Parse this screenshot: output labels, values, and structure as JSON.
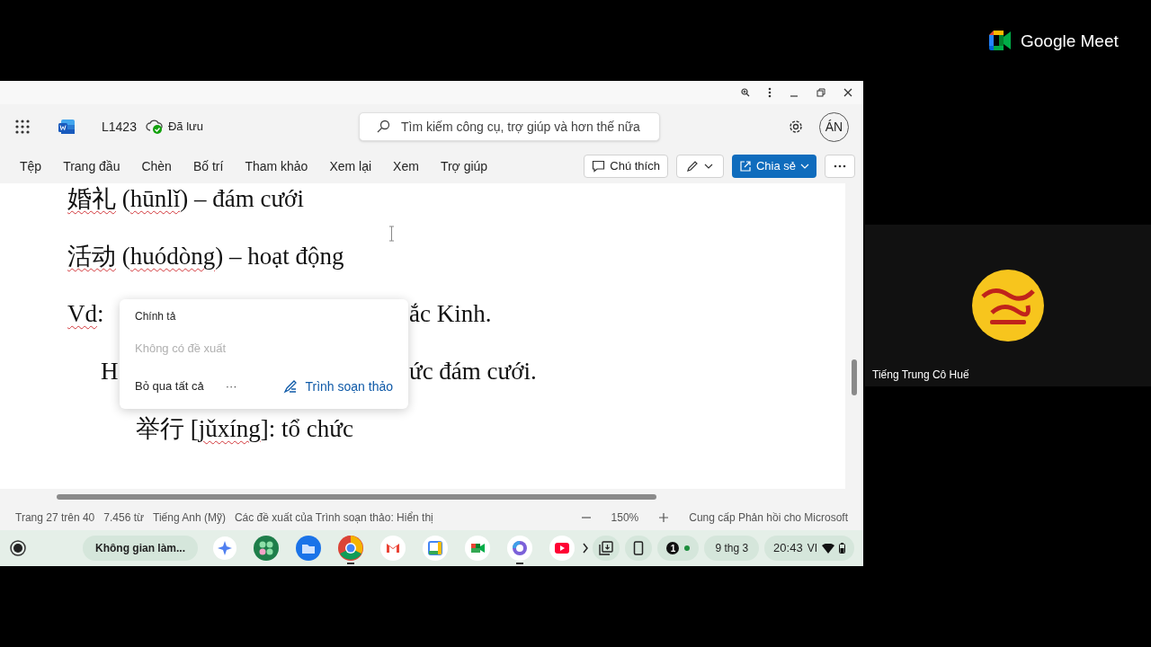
{
  "word": {
    "doc_name": "L1423",
    "save_status": "Đã lưu",
    "search": {
      "placeholder": "Tìm kiếm công cụ, trợ giúp và hơn thế nữa"
    },
    "avatar": "ÁN",
    "ribbon_tabs": [
      "Tệp",
      "Trang đầu",
      "Chèn",
      "Bố trí",
      "Tham khảo",
      "Xem lại",
      "Xem",
      "Trợ giúp"
    ],
    "comment_button": "Chú thích",
    "share_button": "Chia sẻ",
    "document": {
      "lines": [
        {
          "kind": "entry",
          "parts": [
            [
              {
                "text": "婚礼",
                "misspelled": true
              },
              {
                "text": " (",
                "misspelled": false
              },
              {
                "text": "hūnlǐ",
                "misspelled": true
              },
              {
                "text": ") – đám cưới",
                "misspelled": false
              }
            ]
          ]
        },
        {
          "kind": "entry",
          "parts": [
            [
              {
                "text": "活动",
                "misspelled": true
              },
              {
                "text": " (",
                "misspelled": false
              },
              {
                "text": "huódòng",
                "misspelled": true
              },
              {
                "text": ") – hoạt động",
                "misspelled": false
              }
            ]
          ]
        },
        {
          "kind": "entry",
          "parts": [
            [
              {
                "text": "Vd",
                "misspelled": true
              },
              {
                "text": ":",
                "misspelled": false
              }
            ],
            [
              {
                "text": "ắc Kinh.",
                "misspelled": false
              }
            ]
          ]
        },
        {
          "kind": "example",
          "parts": [
            [
              {
                "text": "H",
                "misspelled": false
              }
            ],
            [
              {
                "text": "ức đám cưới.",
                "misspelled": false
              }
            ]
          ]
        },
        {
          "kind": "vocab",
          "parts": [
            [
              {
                "text": "举行 [",
                "misspelled": false
              },
              {
                "text": "jǔxíng",
                "misspelled": true
              },
              {
                "text": "]: tổ chức",
                "misspelled": false
              }
            ]
          ]
        }
      ]
    },
    "spelling_popup": {
      "title": "Chính tả",
      "empty_message": "Không có đề xuất",
      "ignore_all": "Bỏ qua tất cả",
      "more": "···",
      "editor_link": "Trình soạn thảo"
    },
    "status_bar": {
      "page": "Trang 27 trên 40",
      "words": "7.456 từ",
      "language": "Tiếng Anh (Mỹ)",
      "editor_suggestions": "Các đề xuất của Trình soạn thảo: Hiển thị",
      "zoom": "150%",
      "feedback": "Cung cấp Phản hồi cho Microsoft"
    }
  },
  "shelf": {
    "desk": "Không gian làm...",
    "apps": [
      {
        "kind": "assistant",
        "running": false
      },
      {
        "kind": "apps",
        "running": false
      },
      {
        "kind": "files",
        "running": false
      },
      {
        "kind": "browser",
        "running": true
      },
      {
        "kind": "mail",
        "running": false
      },
      {
        "kind": "calendar",
        "running": false
      },
      {
        "kind": "meet",
        "running": false
      },
      {
        "kind": "copilot",
        "running": true
      },
      {
        "kind": "video",
        "running": false
      }
    ],
    "notification_count": "1",
    "date": "9 thg 3",
    "time": "20:43",
    "input_method": "VI"
  },
  "meet": {
    "brand": "Google Meet",
    "participant": {
      "name": "Tiếng Trung Cô Huế"
    }
  }
}
